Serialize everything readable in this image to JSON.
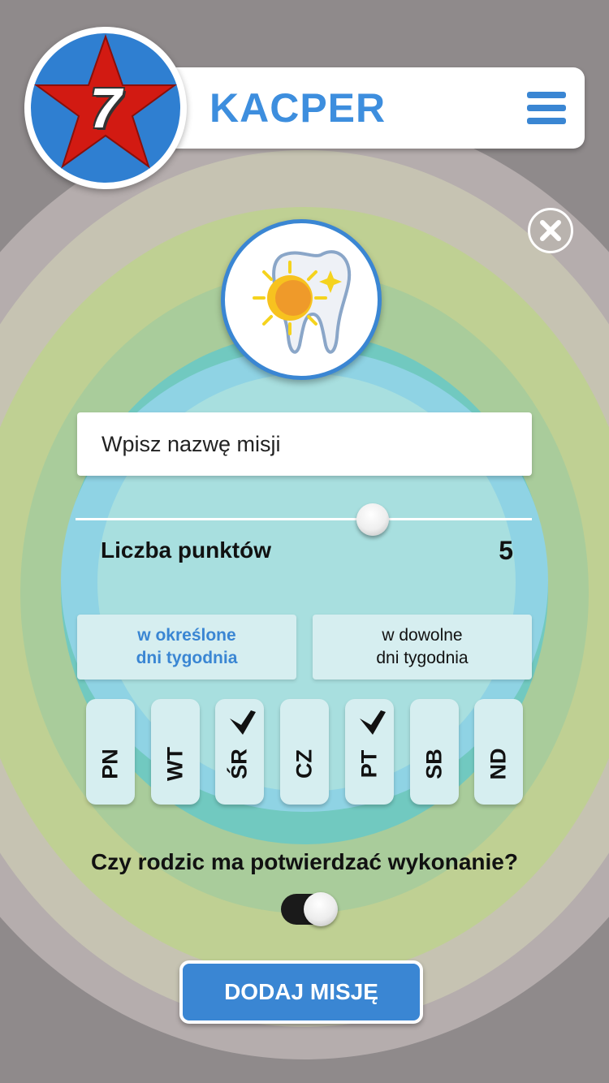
{
  "header": {
    "level": "7",
    "user_name": "KACPER",
    "menu_icon": "hamburger-menu-icon"
  },
  "mission": {
    "icon": "tooth-sun-icon",
    "name_placeholder": "Wpisz nazwę misji",
    "name_value": "",
    "points_label": "Liczba punktów",
    "points_value": "5",
    "points_fraction": 0.65
  },
  "schedule": {
    "mode_specific": "w określone\ndni tygodnia",
    "mode_any": "w dowolne\ndni tygodnia",
    "selected_mode": "specific",
    "days": [
      {
        "label": "PN",
        "checked": false
      },
      {
        "label": "WT",
        "checked": false
      },
      {
        "label": "ŚR",
        "checked": true
      },
      {
        "label": "CZ",
        "checked": false
      },
      {
        "label": "PT",
        "checked": true
      },
      {
        "label": "SB",
        "checked": false
      },
      {
        "label": "ND",
        "checked": false
      }
    ]
  },
  "confirmation": {
    "question": "Czy rodzic ma potwierdzać wykonanie?",
    "enabled": true
  },
  "actions": {
    "add_label": "DODAJ MISJĘ",
    "close_icon": "close-icon"
  },
  "colors": {
    "accent": "#3a86d3",
    "star": "#d21a12",
    "badge_blue": "#2f7fd1"
  }
}
